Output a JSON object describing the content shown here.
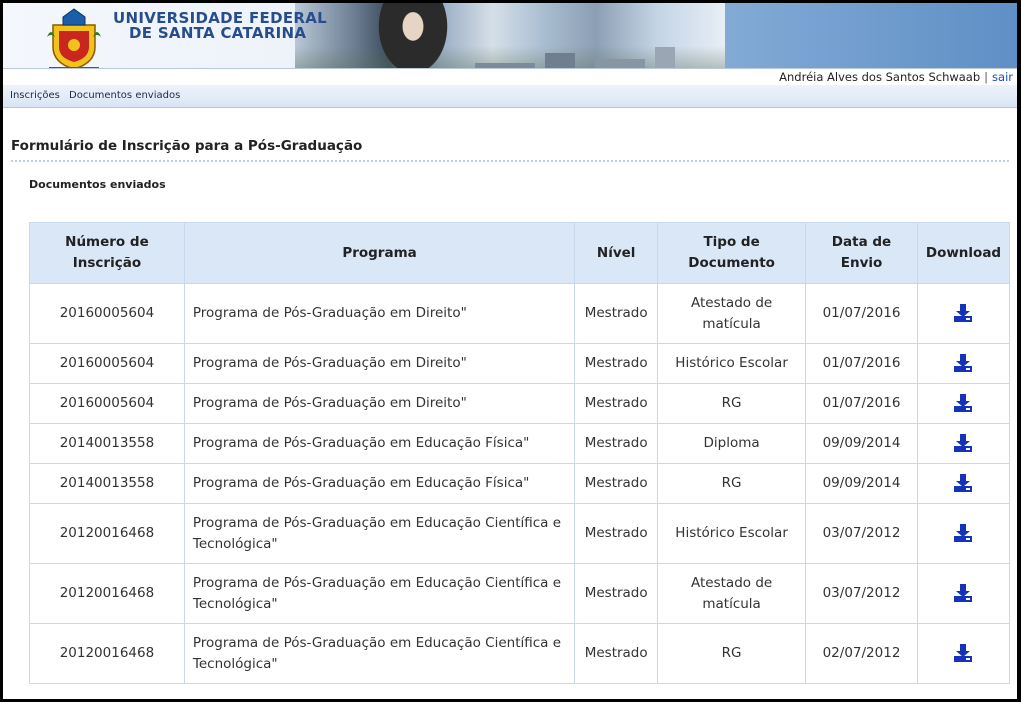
{
  "header": {
    "university_line1": "UNIVERSIDADE FEDERAL",
    "university_line2": "DE SANTA CATARINA",
    "user_name": "Andréia Alves dos Santos Schwaab",
    "separator": "|",
    "logout_label": "sair"
  },
  "nav": {
    "items": [
      {
        "label": "Inscrições"
      },
      {
        "label": "Documentos enviados"
      }
    ]
  },
  "page": {
    "title": "Formulário de Inscrição para a Pós-Graduação",
    "section_title": "Documentos enviados"
  },
  "table": {
    "headers": {
      "numero_line1": "Número de",
      "numero_line2": "Inscrição",
      "programa": "Programa",
      "nivel": "Nível",
      "tipo_line1": "Tipo de",
      "tipo_line2": "Documento",
      "data_line1": "Data de",
      "data_line2": "Envio",
      "download": "Download"
    },
    "rows": [
      {
        "numero": "20160005604",
        "programa": "Programa de Pós-Graduação em Direito\"",
        "nivel": "Mestrado",
        "tipo": "Atestado de matícula",
        "data": "01/07/2016"
      },
      {
        "numero": "20160005604",
        "programa": "Programa de Pós-Graduação em Direito\"",
        "nivel": "Mestrado",
        "tipo": "Histórico Escolar",
        "data": "01/07/2016"
      },
      {
        "numero": "20160005604",
        "programa": "Programa de Pós-Graduação em Direito\"",
        "nivel": "Mestrado",
        "tipo": "RG",
        "data": "01/07/2016"
      },
      {
        "numero": "20140013558",
        "programa": "Programa de Pós-Graduação em Educação Física\"",
        "nivel": "Mestrado",
        "tipo": "Diploma",
        "data": "09/09/2014"
      },
      {
        "numero": "20140013558",
        "programa": "Programa de Pós-Graduação em Educação Física\"",
        "nivel": "Mestrado",
        "tipo": "RG",
        "data": "09/09/2014"
      },
      {
        "numero": "20120016468",
        "programa": "Programa de Pós-Graduação em Educação Científica e Tecnológica\"",
        "nivel": "Mestrado",
        "tipo": "Histórico Escolar",
        "data": "03/07/2012"
      },
      {
        "numero": "20120016468",
        "programa": "Programa de Pós-Graduação em Educação Científica e Tecnológica\"",
        "nivel": "Mestrado",
        "tipo": "Atestado de matícula",
        "data": "03/07/2012"
      },
      {
        "numero": "20120016468",
        "programa": "Programa de Pós-Graduação em Educação Científica e Tecnológica\"",
        "nivel": "Mestrado",
        "tipo": "RG",
        "data": "02/07/2012"
      }
    ]
  },
  "colors": {
    "accent": "#274d8c",
    "link": "#1a4fc0",
    "header_bg": "#d9e7f7",
    "download_icon": "#1433b8"
  },
  "icons": {
    "download": "download-icon",
    "logo": "ufsc-coat-of-arms-icon"
  }
}
